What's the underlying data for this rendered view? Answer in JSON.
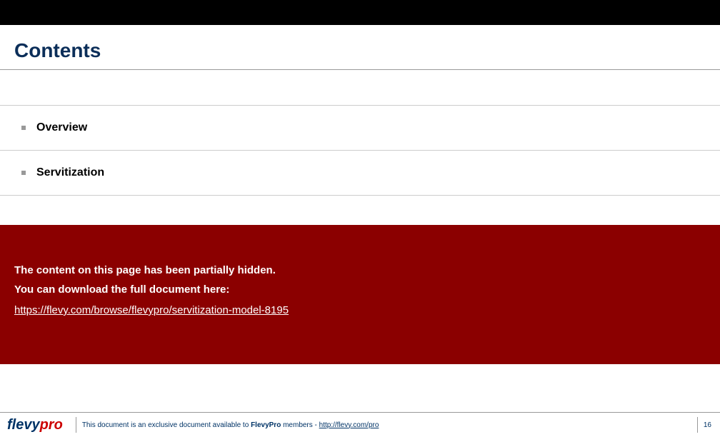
{
  "title": "Contents",
  "toc": [
    {
      "label": "Overview"
    },
    {
      "label": "Servitization"
    }
  ],
  "hidden": {
    "line1": "The content on this page has been partially hidden.",
    "line2": "You can download the full document here:",
    "url": "https://flevy.com/browse/flevypro/servitization-model-8195"
  },
  "footer": {
    "logo_part1": "flevy",
    "logo_part2": "pro",
    "text_prefix": "This document is an exclusive document available to ",
    "text_bold": "FlevyPro",
    "text_mid": " members - ",
    "text_link": "http://flevy.com/pro",
    "page": "16"
  }
}
